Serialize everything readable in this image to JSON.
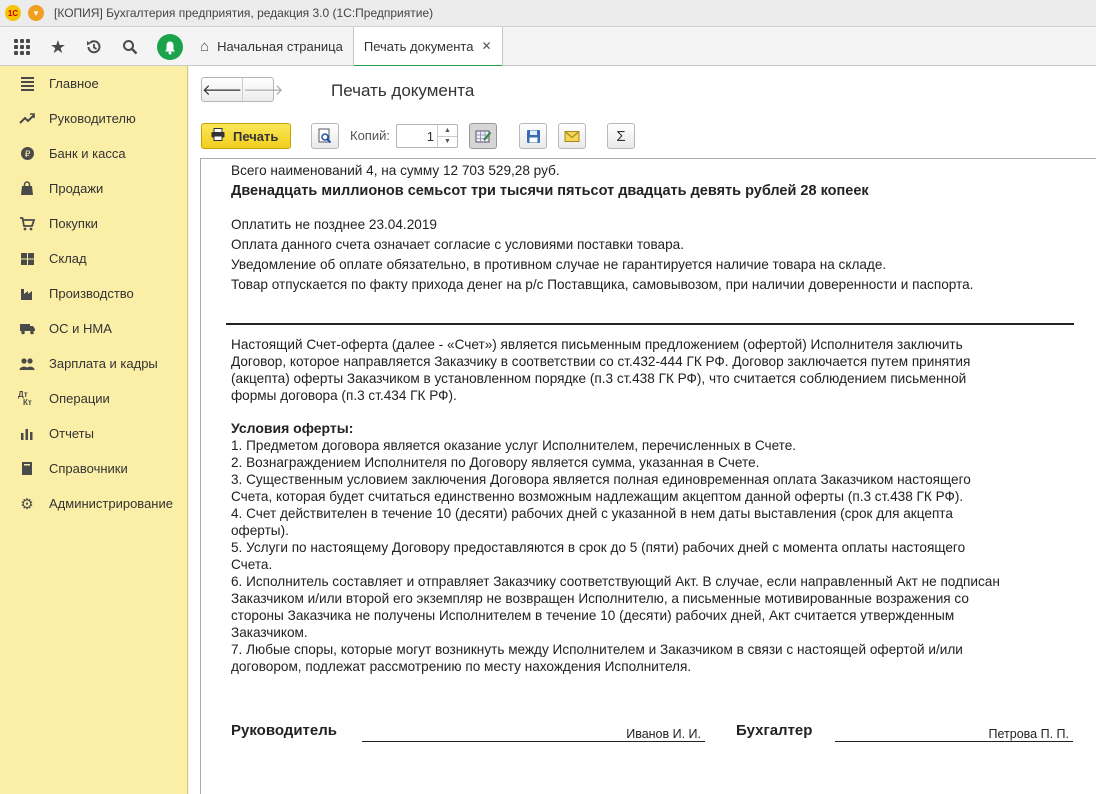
{
  "window": {
    "title": "[КОПИЯ] Бухгалтерия предприятия, редакция 3.0  (1С:Предприятие)",
    "logo_text": "1С"
  },
  "tabs": [
    {
      "label": "Начальная страница"
    },
    {
      "label": "Печать документа",
      "close": "✕"
    }
  ],
  "sidebar": {
    "items": [
      {
        "label": "Главное",
        "icon": "menu-lines-icon"
      },
      {
        "label": "Руководителю",
        "icon": "trend-icon"
      },
      {
        "label": "Банк и касса",
        "icon": "coin-icon"
      },
      {
        "label": "Продажи",
        "icon": "bag-icon"
      },
      {
        "label": "Покупки",
        "icon": "cart-icon"
      },
      {
        "label": "Склад",
        "icon": "warehouse-icon"
      },
      {
        "label": "Производство",
        "icon": "factory-icon"
      },
      {
        "label": "ОС и НМА",
        "icon": "truck-icon"
      },
      {
        "label": "Зарплата и кадры",
        "icon": "people-icon"
      },
      {
        "label": "Операции",
        "icon": "dt-kt-icon"
      },
      {
        "label": "Отчеты",
        "icon": "bar-chart-icon"
      },
      {
        "label": "Справочники",
        "icon": "book-icon"
      },
      {
        "label": "Администрирование",
        "icon": "gear-icon"
      }
    ]
  },
  "page": {
    "title": "Печать документа",
    "print_label": "Печать",
    "copies_label": "Копий:",
    "copies_value": "1"
  },
  "document": {
    "summary": "Всего наименований 4, на сумму 12 703 529,28 руб.",
    "amount_words": "Двенадцать миллионов семьсот три тысячи пятьсот двадцать девять рублей 28 копеек",
    "pay_lines": [
      "Оплатить не позднее 23.04.2019",
      "Оплата данного счета означает согласие с условиями поставки товара.",
      "Уведомление об оплате обязательно, в противном случае не гарантируется наличие товара на складе.",
      "Товар отпускается по факту прихода денег на р/с Поставщика, самовывозом, при наличии доверенности и паспорта."
    ],
    "offer_lines": [
      "Настоящий Счет-оферта (далее - «Счет») является письменным предложением (офертой) Исполнителя заключить",
      "Договор, которое направляется Заказчику в соответствии со ст.432-444 ГК РФ.  Договор заключается путем принятия",
      "(акцепта) оферты Заказчиком в установленном порядке (п.3 ст.438 ГК РФ), что считается соблюдением письменной",
      "формы договора (п.3 ст.434 ГК РФ)."
    ],
    "conditions_title": "Условия оферты:",
    "conditions_lines": [
      "1. Предметом договора является оказание услуг Исполнителем, перечисленных в Счете.",
      "2. Вознаграждением Исполнителя по Договору является сумма, указанная в Счете.",
      "3. Существенным условием заключения Договора является полная единовременная оплата Заказчиком настоящего",
      "Счета, которая будет считаться единственно возможным надлежащим акцептом данной оферты (п.3 ст.438 ГК РФ).",
      "4. Счет действителен в течение 10 (десяти) рабочих дней с указанной в нем даты выставления (срок для акцепта",
      "оферты).",
      "5. Услуги по настоящему Договору предоставляются в срок до 5 (пяти) рабочих дней с момента оплаты настоящего",
      "Счета.",
      "6. Исполнитель составляет и отправляет Заказчику соответствующий Акт. В случае, если направленный Акт не подписан",
      "Заказчиком и/или второй его экземпляр не возвращен Исполнителю, а письменные мотивированные возражения со",
      "стороны Заказчика не получены Исполнителем в течение 10 (десяти) рабочих дней, Акт считается утвержденным",
      "Заказчиком.",
      "7. Любые споры, которые могут возникнуть между Исполнителем и Заказчиком в связи с настоящей офертой и/или",
      "договором, подлежат рассмотрению по месту нахождения Исполнителя."
    ],
    "signatures": {
      "head_label": "Руководитель",
      "head_name": "Иванов И. И.",
      "accountant_label": "Бухгалтер",
      "accountant_name": "Петрова П. П."
    }
  },
  "colors": {
    "sidebar_bg": "#fbeea6",
    "print_button": "#f2cf1d",
    "accent_green": "#2aa14f"
  }
}
